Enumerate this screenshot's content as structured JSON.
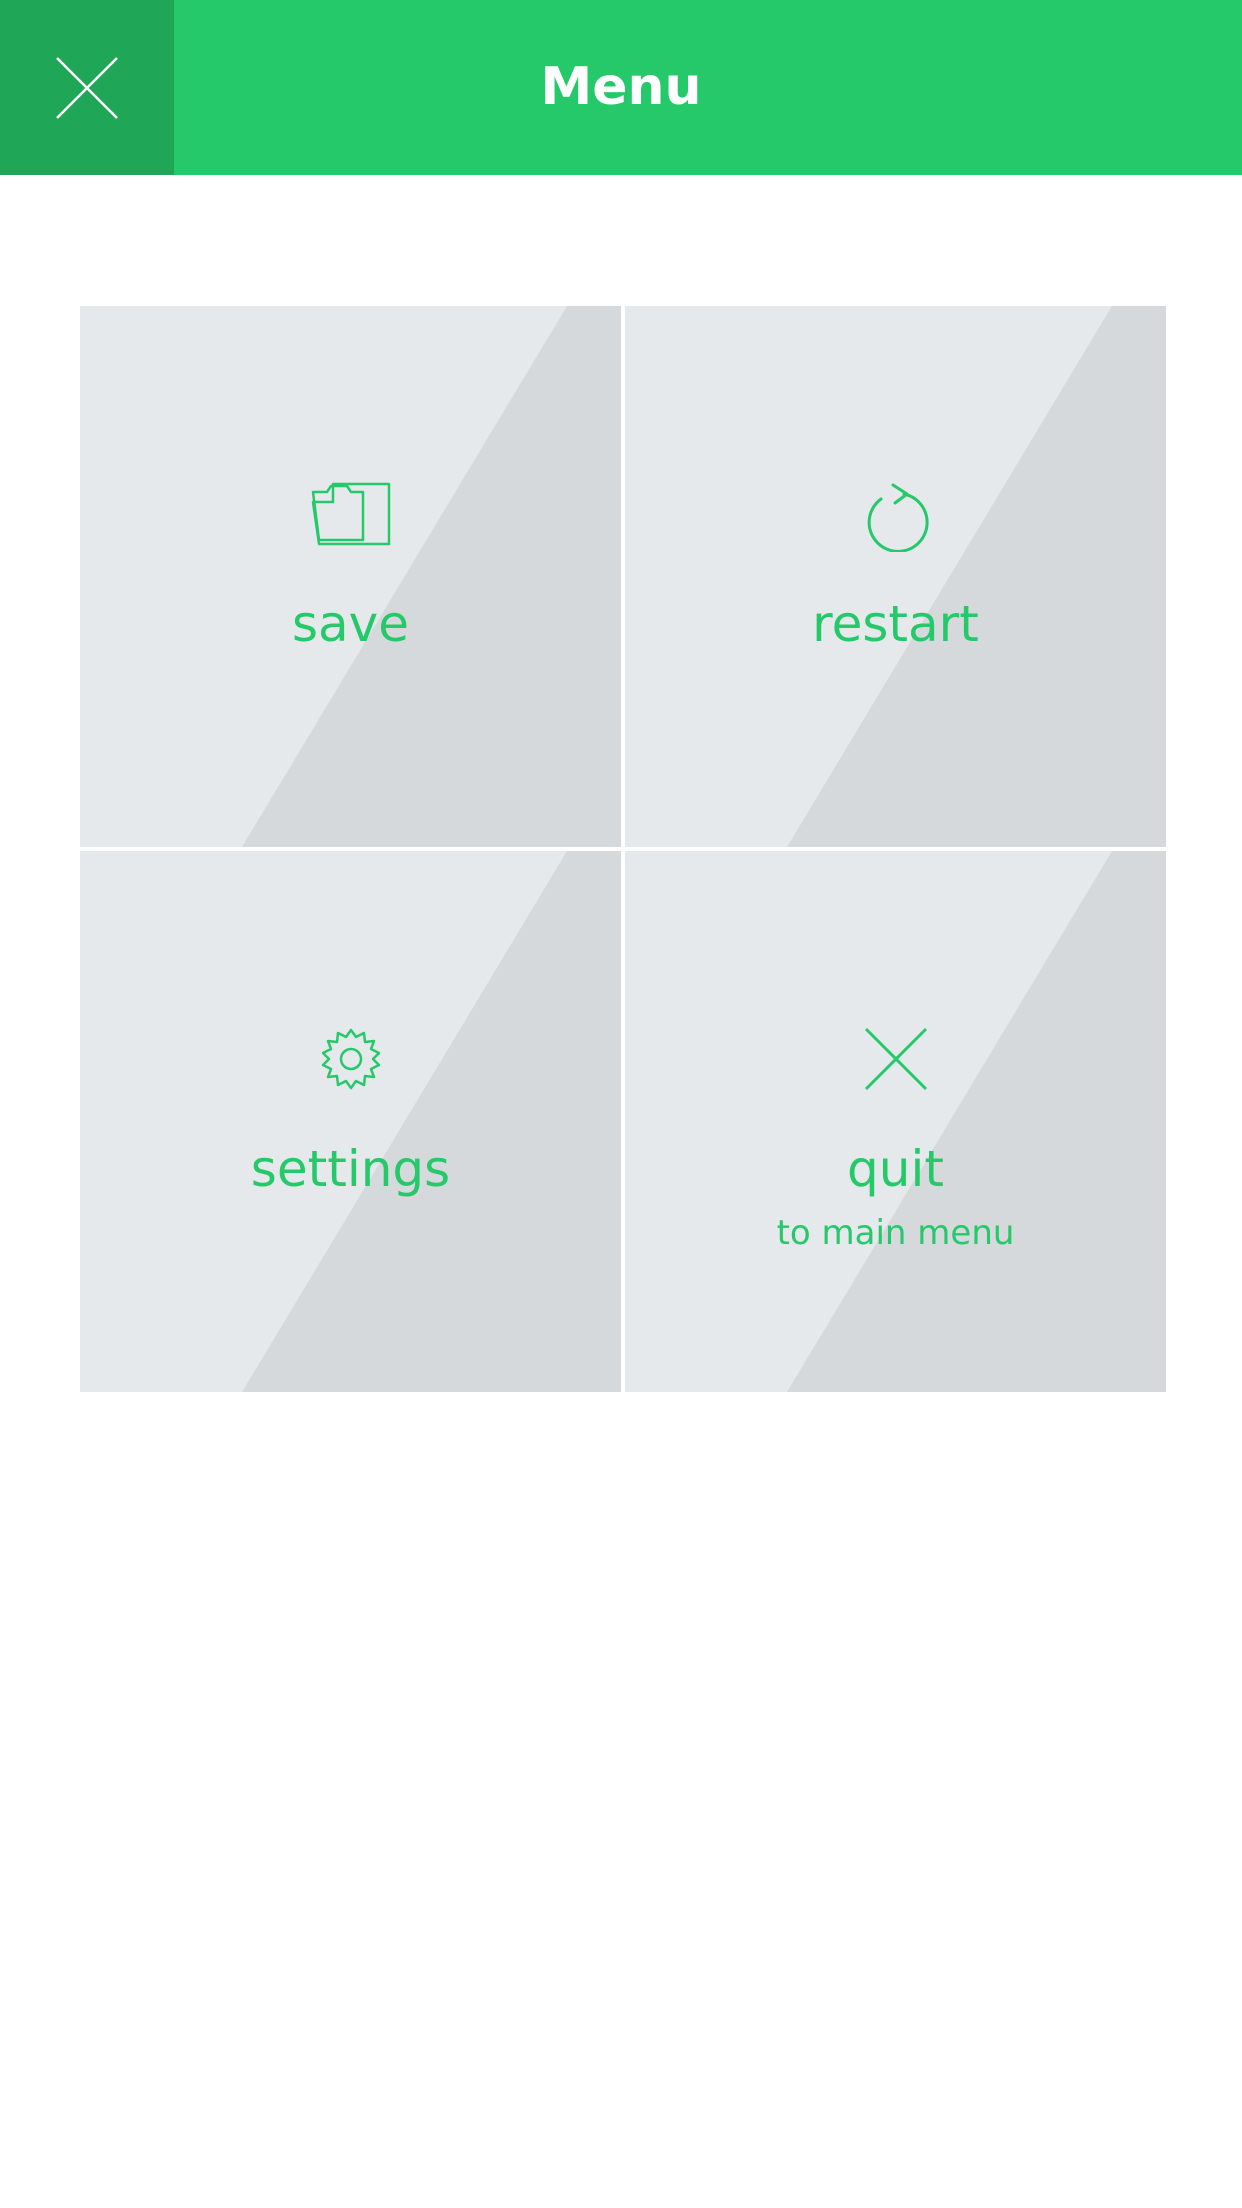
{
  "header": {
    "title": "Menu",
    "close_icon": "close-icon",
    "background_color": "#25c96a",
    "close_background_color": "#1fa656"
  },
  "menu": {
    "accent_color": "#25c96a",
    "tile_light_color": "#e5e9ec",
    "tile_dark_color": "#d5d9dc",
    "items": [
      {
        "label": "save",
        "sublabel": "",
        "icon": "folder-icon"
      },
      {
        "label": "restart",
        "sublabel": "",
        "icon": "restart-icon"
      },
      {
        "label": "settings",
        "sublabel": "",
        "icon": "gear-icon"
      },
      {
        "label": "quit",
        "sublabel": "to main menu",
        "icon": "close-icon"
      }
    ]
  }
}
